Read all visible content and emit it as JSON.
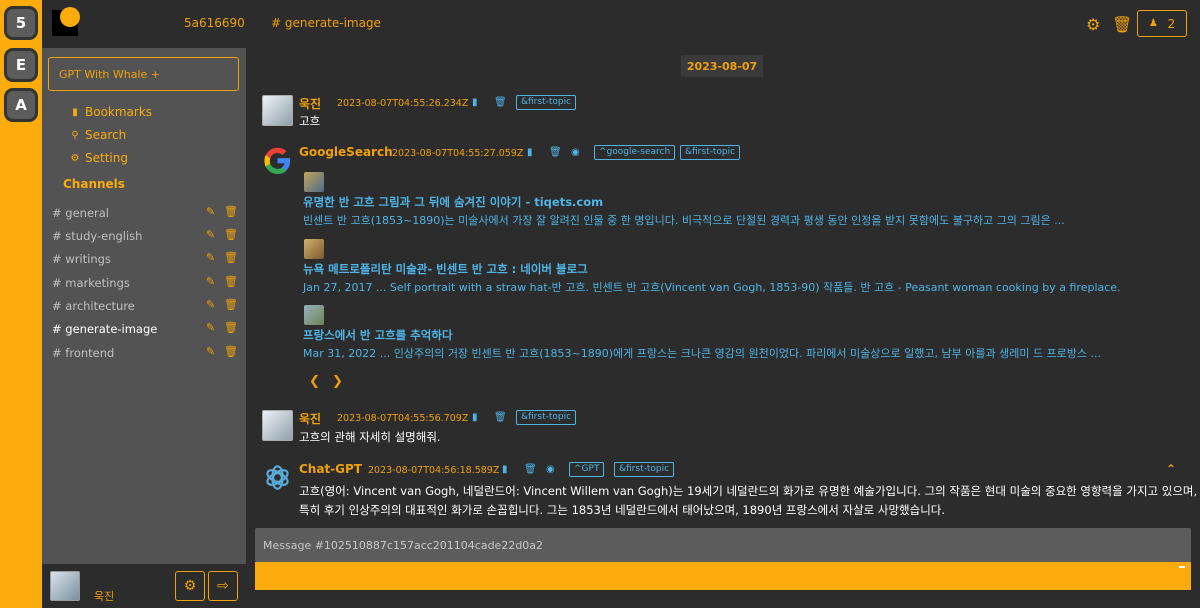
{
  "servers": [
    "5",
    "E",
    "A"
  ],
  "sidebar": {
    "user_id": "5a616690",
    "gpt_label": "GPT With Whale +",
    "nav": [
      {
        "label": "Bookmarks",
        "icon": "bookmark-icon"
      },
      {
        "label": "Search",
        "icon": "search-icon"
      },
      {
        "label": "Setting",
        "icon": "gear-icon"
      }
    ],
    "channels_title": "Channels",
    "channels": [
      "# general",
      "# study-english",
      "# writings",
      "# marketings",
      "# architecture",
      "# generate-image",
      "# frontend"
    ],
    "active_channel": "# generate-image",
    "user_name": "욱진"
  },
  "header": {
    "channel": "# generate-image",
    "members_count": "2"
  },
  "date": "2023-08-07",
  "messages": [
    {
      "author": "욱진",
      "timestamp": "2023-08-07T04:55:26.234Z",
      "tags": [
        "&first-topic"
      ],
      "text": "고흐"
    },
    {
      "author": "GoogleSearch",
      "timestamp": "2023-08-07T04:55:27.059Z",
      "tags": [
        "^google-search",
        "&first-topic"
      ],
      "results": [
        {
          "title": "유명한 반 고흐 그림과 그 뒤에 숨겨진 이야기 - tiqets.com",
          "desc": "빈센트 반 고흐(1853~1890)는 미술사에서 가장 잘 알려진 인물 중 한 명입니다. 비극적으로 단절된 경력과 평생 동안 인정을 받지 못함에도 불구하고 그의 그림은 ..."
        },
        {
          "title": "뉴욕 메트로폴리탄 미술관- 빈센트 반 고흐 : 네이버 블로그",
          "desc": "Jan 27, 2017 ... Self portrait with a straw hat-반 고흐. 빈센트 반 고흐(Vincent van Gogh, 1853-90) 작품들. 반 고흐 - Peasant woman cooking by a fireplace."
        },
        {
          "title": "프랑스에서 반 고흐를 추억하다",
          "desc": "Mar 31, 2022 ... 인상주의의 거장 빈센트 반 고흐(1853~1890)에게 프랑스는 크나큰 영감의 원천이었다. 파리에서 미술상으로 일했고, 남부 아를과 생레미 드 프로방스 ..."
        }
      ]
    },
    {
      "author": "욱진",
      "timestamp": "2023-08-07T04:55:56.709Z",
      "tags": [
        "&first-topic"
      ],
      "text": "고흐의 관해 자세히 설명해줘."
    },
    {
      "author": "Chat-GPT",
      "timestamp": "2023-08-07T04:56:18.589Z",
      "tags": [
        "^GPT",
        "&first-topic"
      ],
      "lines": [
        "고흐(영어: Vincent van Gogh, 네덜란드어: Vincent Willem van Gogh)는 19세기 네덜란드의 화가로 유명한 예술가입니다. 그의 작품은 현대 미술의 중요한 영향력을 가지고 있으며,",
        "특히 후기 인상주의의 대표적인 화가로 손꼽힙니다. 그는 1853년 네덜란드에서 태어났으며, 1890년 프랑스에서 자살로 사망했습니다."
      ]
    }
  ],
  "input": {
    "placeholder": "Message #102510887c157acc201104cade22d0a2"
  },
  "colors": {
    "accent": "#fbab0b",
    "link": "#4fb4e6",
    "background": "#2c2c2c",
    "sidebar": "#535353"
  }
}
